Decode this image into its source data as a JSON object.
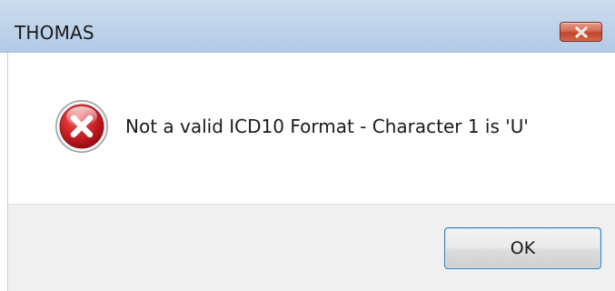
{
  "dialog": {
    "title": "THOMAS",
    "message": "Not a valid ICD10 Format - Character 1 is 'U'",
    "ok_label": "OK",
    "icons": {
      "close": "close-icon",
      "error": "error-icon"
    },
    "colors": {
      "close_button": "#c2452c",
      "error_icon": "#d32027",
      "titlebar": "#bfd3ea",
      "footer": "#f0f0f0"
    }
  }
}
